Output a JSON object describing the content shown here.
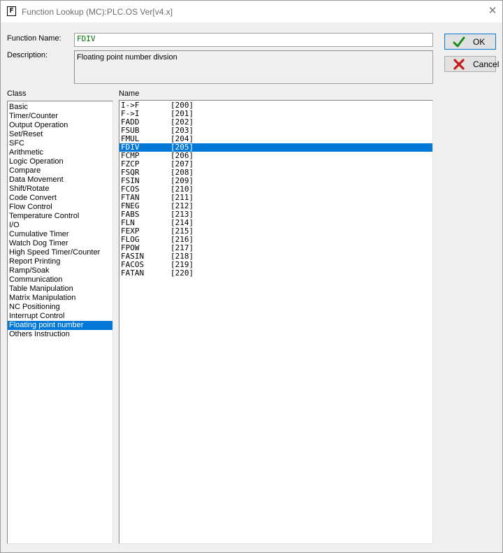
{
  "window": {
    "title": "Function Lookup (MC):PLC.OS Ver[v4.x]",
    "icon_letter": "F",
    "close_symbol": "✕"
  },
  "form": {
    "function_name_label": "Function Name:",
    "function_name_value": "FDIV",
    "description_label": "Description:",
    "description_value": "Floating point number divsion"
  },
  "buttons": {
    "ok_label": "OK",
    "cancel_label": "Cancel"
  },
  "class_list": {
    "header": "Class",
    "selected": "Floating point number",
    "items": [
      "Basic",
      "Timer/Counter",
      "Output Operation",
      "Set/Reset",
      "SFC",
      "Arithmetic",
      "Logic Operation",
      "Compare",
      "Data Movement",
      "Shift/Rotate",
      "Code Convert",
      "Flow Control",
      "Temperature Control",
      "I/O",
      "Cumulative Timer",
      "Watch Dog Timer",
      "High Speed Timer/Counter",
      "Report Printing",
      "Ramp/Soak",
      "Communication",
      "Table Manipulation",
      "Matrix Manipulation",
      "NC Positioning",
      "Interrupt Control",
      "Floating point number",
      "Others Instruction"
    ]
  },
  "name_list": {
    "header": "Name",
    "selected": "FDIV",
    "items": [
      {
        "name": "I->F",
        "code": "[200]"
      },
      {
        "name": "F->I",
        "code": "[201]"
      },
      {
        "name": "FADD",
        "code": "[202]"
      },
      {
        "name": "FSUB",
        "code": "[203]"
      },
      {
        "name": "FMUL",
        "code": "[204]"
      },
      {
        "name": "FDIV",
        "code": "[205]"
      },
      {
        "name": "FCMP",
        "code": "[206]"
      },
      {
        "name": "FZCP",
        "code": "[207]"
      },
      {
        "name": "FSQR",
        "code": "[208]"
      },
      {
        "name": "FSIN",
        "code": "[209]"
      },
      {
        "name": "FCOS",
        "code": "[210]"
      },
      {
        "name": "FTAN",
        "code": "[211]"
      },
      {
        "name": "FNEG",
        "code": "[212]"
      },
      {
        "name": "FABS",
        "code": "[213]"
      },
      {
        "name": "FLN",
        "code": "[214]"
      },
      {
        "name": "FEXP",
        "code": "[215]"
      },
      {
        "name": "FLOG",
        "code": "[216]"
      },
      {
        "name": "FPOW",
        "code": "[217]"
      },
      {
        "name": "FASIN",
        "code": "[218]"
      },
      {
        "name": "FACOS",
        "code": "[219]"
      },
      {
        "name": "FATAN",
        "code": "[220]"
      }
    ]
  },
  "colors": {
    "selection": "#0078d7",
    "function_name_text": "#007400",
    "ok_icon": "#1a8a1a",
    "cancel_icon": "#c41a1a"
  },
  "icons": {
    "ok": "check-icon",
    "cancel": "x-icon",
    "close": "close-icon"
  }
}
